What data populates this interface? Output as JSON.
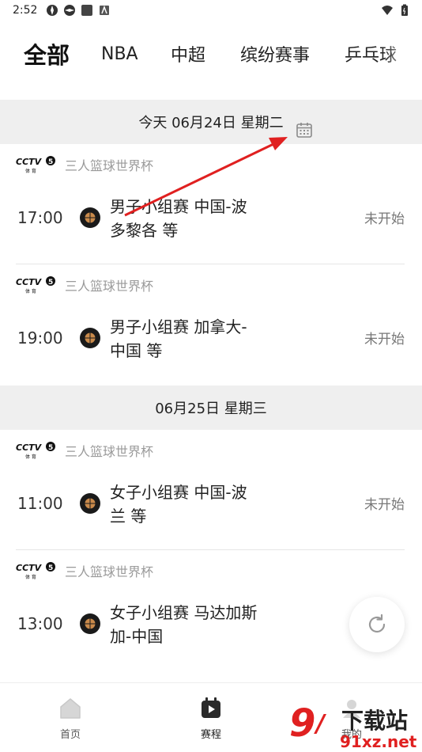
{
  "status_bar": {
    "time": "2:52"
  },
  "tabs": [
    {
      "label": "全部",
      "active": true
    },
    {
      "label": "NBA",
      "active": false
    },
    {
      "label": "中超",
      "active": false
    },
    {
      "label": "缤纷赛事",
      "active": false
    },
    {
      "label": "乒乓球",
      "active": false
    }
  ],
  "day1": {
    "label": "今天 06月24日  星期二"
  },
  "day2": {
    "label": "06月25日  星期三"
  },
  "matches": [
    {
      "channel": "CCTV5 体育",
      "league": "三人篮球世界杯",
      "time": "17:00",
      "title": "男子小组赛 中国-波多黎各 等",
      "status": "未开始"
    },
    {
      "channel": "CCTV5 体育",
      "league": "三人篮球世界杯",
      "time": "19:00",
      "title": "男子小组赛 加拿大-中国 等",
      "status": "未开始"
    },
    {
      "channel": "CCTV5 体育",
      "league": "三人篮球世界杯",
      "time": "11:00",
      "title": "女子小组赛  中国-波兰 等",
      "status": "未开始"
    },
    {
      "channel": "CCTV5 体育",
      "league": "三人篮球世界杯",
      "time": "13:00",
      "title": "女子小组赛 马达加斯加-中国",
      "status": ""
    }
  ],
  "bottom_nav": [
    {
      "label": "首页",
      "icon": "home-icon"
    },
    {
      "label": "赛程",
      "icon": "schedule-icon"
    },
    {
      "label": "我的",
      "icon": "profile-icon"
    }
  ],
  "watermark": {
    "text": "下载站",
    "url_text": "91xz.net"
  },
  "colors": {
    "accent_red": "#e02020",
    "header_bg": "#efefef",
    "muted": "#9a9a9a"
  }
}
